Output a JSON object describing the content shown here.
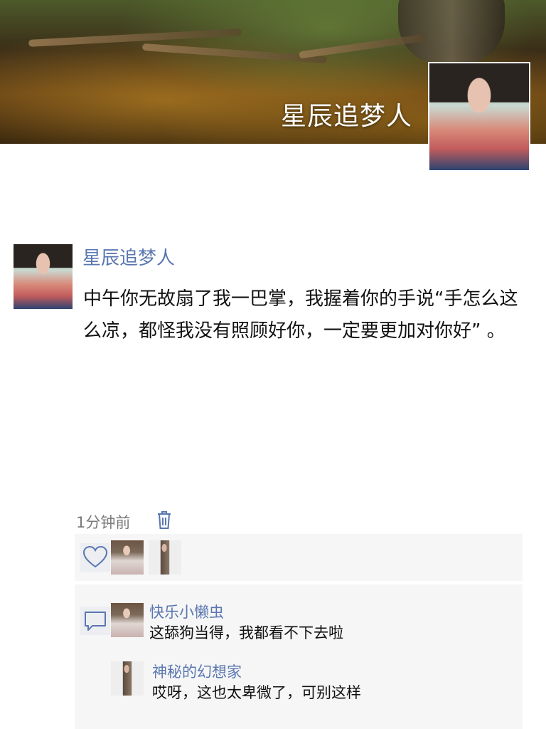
{
  "profile": {
    "cover_title": "星辰追梦人"
  },
  "post": {
    "author": "星辰追梦人",
    "text": "中午你无故扇了我一巴掌，我握着你的手说“手怎么这么凉，都怪我没有照顾好你，一定要更加对你好” 。",
    "time": "1分钟前"
  },
  "comments": [
    {
      "author": "快乐小懒虫",
      "text": "这舔狗当得，我都看不下去啦"
    },
    {
      "author": "神秘的幻想家",
      "text": "哎呀，这也太卑微了，可别这样"
    }
  ],
  "icons": {
    "like": "heart-icon",
    "comment": "comment-icon",
    "delete": "trash-icon"
  },
  "colors": {
    "name_link": "#5a76b0",
    "panel_bg": "#f6f6f6",
    "body_text": "#111111",
    "meta_text": "#7a7a7a"
  }
}
